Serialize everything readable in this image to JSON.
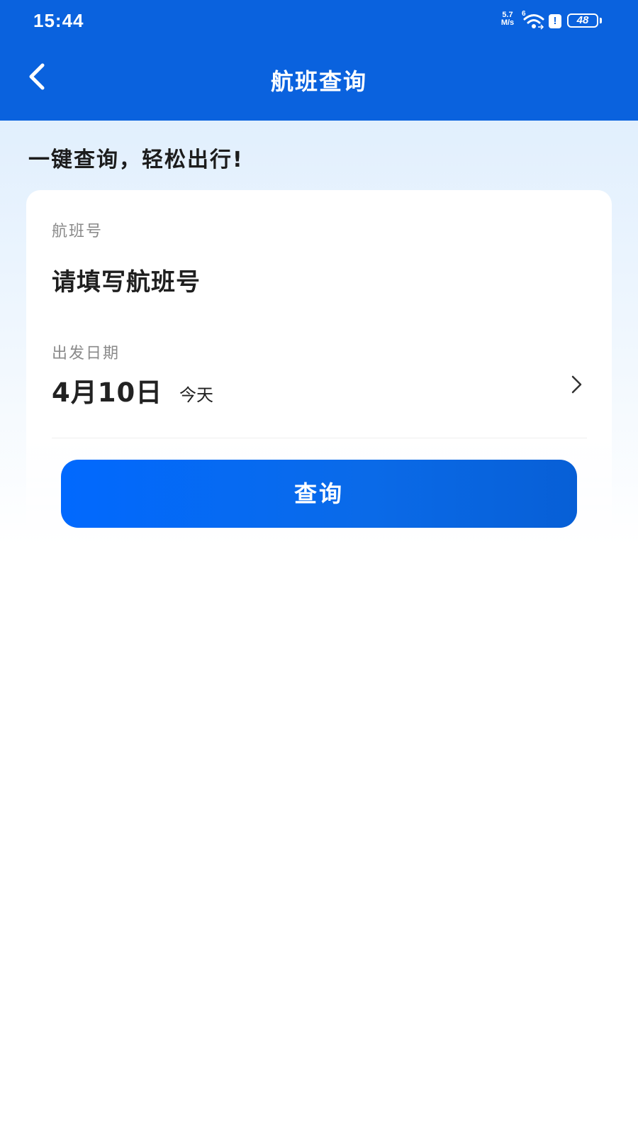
{
  "status_bar": {
    "time": "15:44",
    "network_speed_value": "5.7",
    "network_speed_unit": "M/s",
    "wifi_network": "6",
    "alert": "!",
    "battery": "48"
  },
  "nav": {
    "title": "航班查询"
  },
  "hero": {
    "slogan": "一键查询，轻松出行!"
  },
  "form": {
    "flight_number_label": "航班号",
    "flight_number_placeholder": "请填写航班号",
    "flight_number_value": "",
    "departure_date_label": "出发日期",
    "departure_date_value": "4月10日",
    "departure_date_relative": "今天"
  },
  "actions": {
    "query_label": "查询"
  },
  "colors": {
    "header_blue": "#0a62de",
    "button_blue": "#0169fe"
  },
  "icons": {
    "back": "chevron-left-icon",
    "date_picker": "chevron-right-icon",
    "wifi": "wifi-icon",
    "alert": "alert-icon",
    "battery": "battery-icon"
  }
}
